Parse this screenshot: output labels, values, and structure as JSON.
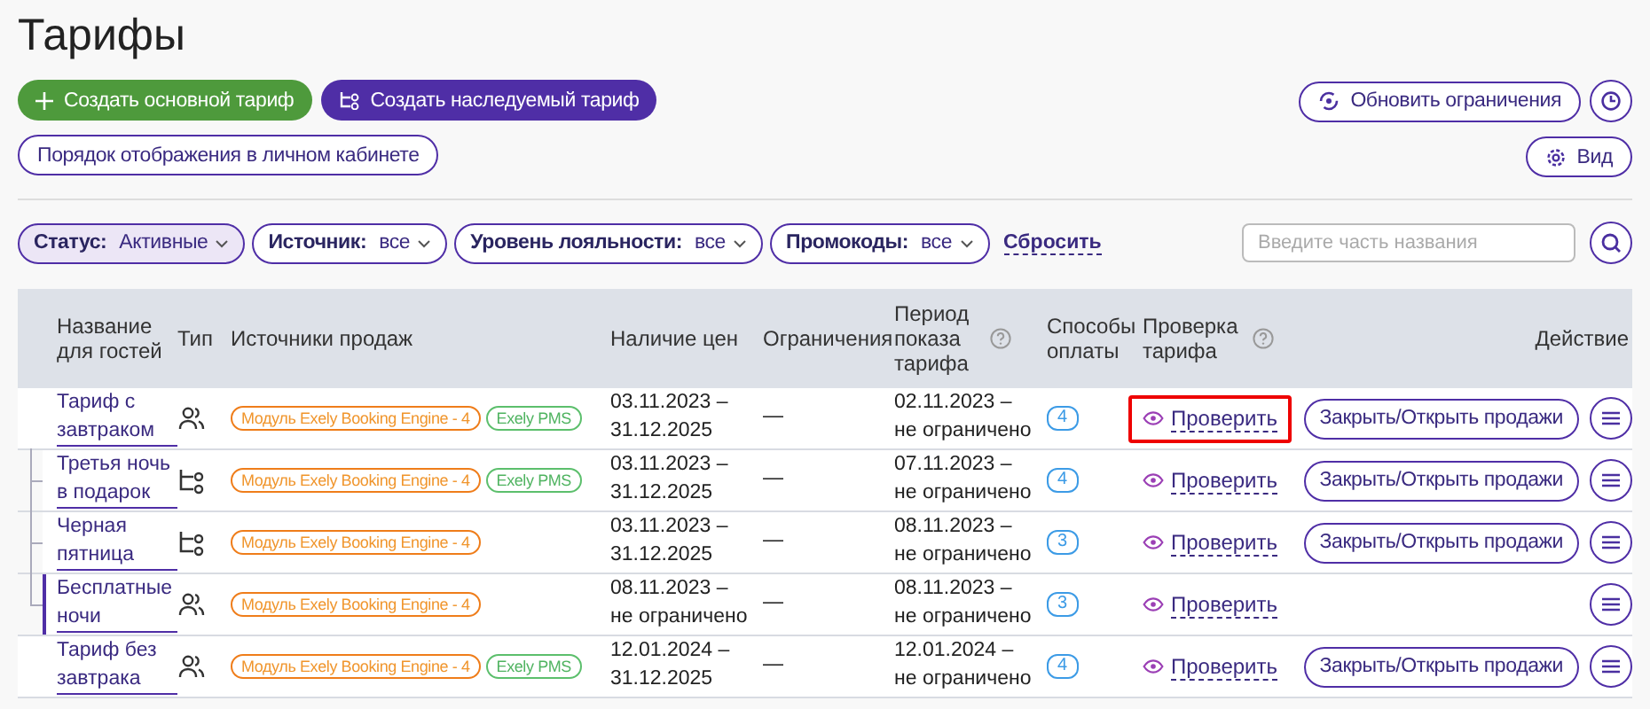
{
  "title": "Тарифы",
  "create_buttons": [
    {
      "label": "Создать основной тариф",
      "kind": "base"
    },
    {
      "label": "Создать наследуемый тариф",
      "kind": "derived"
    }
  ],
  "order_button": "Порядок отображения в личном кабинете",
  "update_button": "Обновить ограничения",
  "view_button": "Вид",
  "filters": [
    {
      "label": "Статус:",
      "value": "Активные",
      "selected": true
    },
    {
      "label": "Источник:",
      "value": "все",
      "selected": false
    },
    {
      "label": "Уровень лояльности:",
      "value": "все",
      "selected": false
    },
    {
      "label": "Промокоды:",
      "value": "все",
      "selected": false
    }
  ],
  "reset_link": "Сбросить",
  "search": {
    "placeholder": "Введите часть названия"
  },
  "table": {
    "columns": [
      {
        "label": "Название для гостей",
        "help": false
      },
      {
        "label": "Тип",
        "help": false
      },
      {
        "label": "Источники продаж",
        "help": false
      },
      {
        "label": "Наличие цен",
        "help": false
      },
      {
        "label": "Ограничения",
        "help": false
      },
      {
        "label": "Период показа тарифа",
        "help": true
      },
      {
        "label": "Способы оплаты",
        "help": false
      },
      {
        "label": "Проверка тарифа",
        "help": true
      },
      {
        "label": "Действие",
        "help": false
      }
    ],
    "rows": [
      {
        "name": "Тариф с завтраком",
        "kind": "base",
        "sources": [
          {
            "label": "Модуль Exely Booking Engine - 4",
            "kind": "module"
          },
          {
            "label": "Exely PMS",
            "kind": "pms"
          }
        ],
        "prices": [
          "03.11.2023 –",
          "31.12.2025"
        ],
        "restrictions": "—",
        "display_period": [
          "02.11.2023 –",
          "не ограничено"
        ],
        "payments": "4",
        "check": "Проверить",
        "sales_button": "Закрыть/Открыть продажи",
        "highlighted": true,
        "selected": false,
        "children": [
          {
            "name": "Третья ночь в подарок",
            "kind": "derived",
            "sources": [
              {
                "label": "Модуль Exely Booking Engine - 4",
                "kind": "module"
              },
              {
                "label": "Exely PMS",
                "kind": "pms"
              }
            ],
            "prices": [
              "03.11.2023 –",
              "31.12.2025"
            ],
            "restrictions": "—",
            "display_period": [
              "07.11.2023 –",
              "не ограничено"
            ],
            "payments": "4",
            "check": "Проверить",
            "sales_button": "Закрыть/Открыть продажи",
            "highlighted": false,
            "selected": false
          },
          {
            "name": "Черная пятница",
            "kind": "derived",
            "sources": [
              {
                "label": "Модуль Exely Booking Engine - 4",
                "kind": "module"
              }
            ],
            "prices": [
              "03.11.2023 –",
              "31.12.2025"
            ],
            "restrictions": "—",
            "display_period": [
              "08.11.2023 –",
              "не ограничено"
            ],
            "payments": "3",
            "check": "Проверить",
            "sales_button": "Закрыть/Открыть продажи",
            "highlighted": false,
            "selected": false
          },
          {
            "name": "Бесплатные ночи",
            "kind": "base",
            "sources": [
              {
                "label": "Модуль Exely Booking Engine - 4",
                "kind": "module"
              }
            ],
            "prices": [
              "08.11.2023 –",
              "не ограничено"
            ],
            "restrictions": "—",
            "display_period": [
              "08.11.2023 –",
              "не ограничено"
            ],
            "payments": "3",
            "check": "Проверить",
            "highlighted": false,
            "selected": true
          }
        ]
      },
      {
        "name": "Тариф без завтрака",
        "kind": "base",
        "sources": [
          {
            "label": "Модуль Exely Booking Engine - 4",
            "kind": "module"
          },
          {
            "label": "Exely PMS",
            "kind": "pms"
          }
        ],
        "prices": [
          "12.01.2024 –",
          "31.12.2025"
        ],
        "restrictions": "—",
        "display_period": [
          "12.01.2024 –",
          "не ограничено"
        ],
        "payments": "4",
        "check": "Проверить",
        "sales_button": "Закрыть/Открыть продажи",
        "highlighted": false,
        "selected": false
      }
    ]
  }
}
